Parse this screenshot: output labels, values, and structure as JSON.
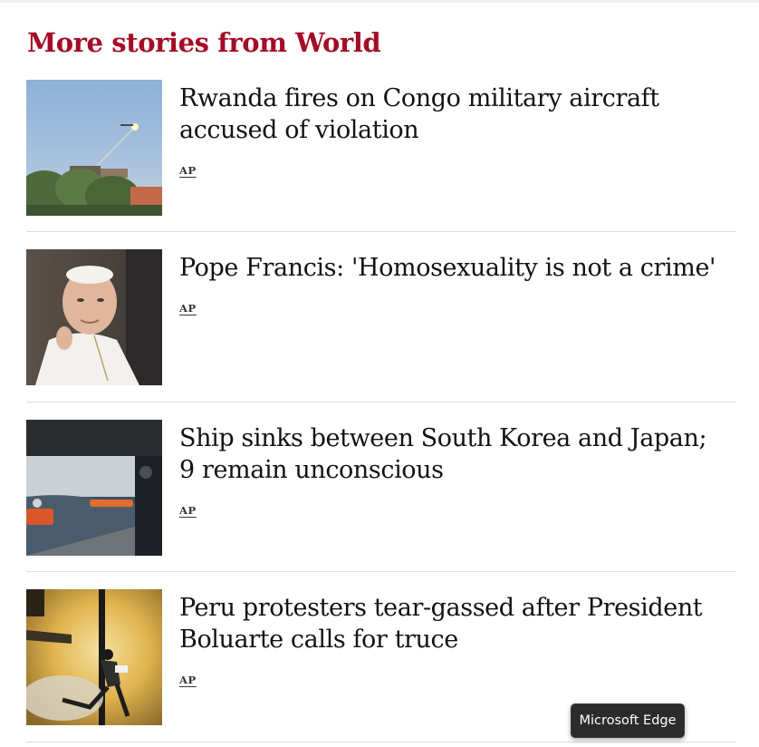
{
  "section": {
    "title": "More stories from World"
  },
  "stories": [
    {
      "headline": "Rwanda fires on Congo military aircraft accused of violation",
      "source": "AP",
      "image_icon": "drone-photo-icon"
    },
    {
      "headline": "Pope Francis: 'Homosexuality is not a crime'",
      "source": "AP",
      "image_icon": "portrait-photo-icon"
    },
    {
      "headline": "Ship sinks between South Korea and Japan; 9 remain unconscious",
      "source": "AP",
      "image_icon": "sea-rescue-photo-icon"
    },
    {
      "headline": "Peru protesters tear-gassed after President Boluarte calls for truce",
      "source": "AP",
      "image_icon": "protest-photo-icon"
    }
  ],
  "tooltip": {
    "text": "Microsoft Edge"
  },
  "colors": {
    "section_title": "#a50b25",
    "headline": "#121212",
    "divider": "#dcdcdc",
    "tooltip_bg": "#2b2b2b"
  }
}
